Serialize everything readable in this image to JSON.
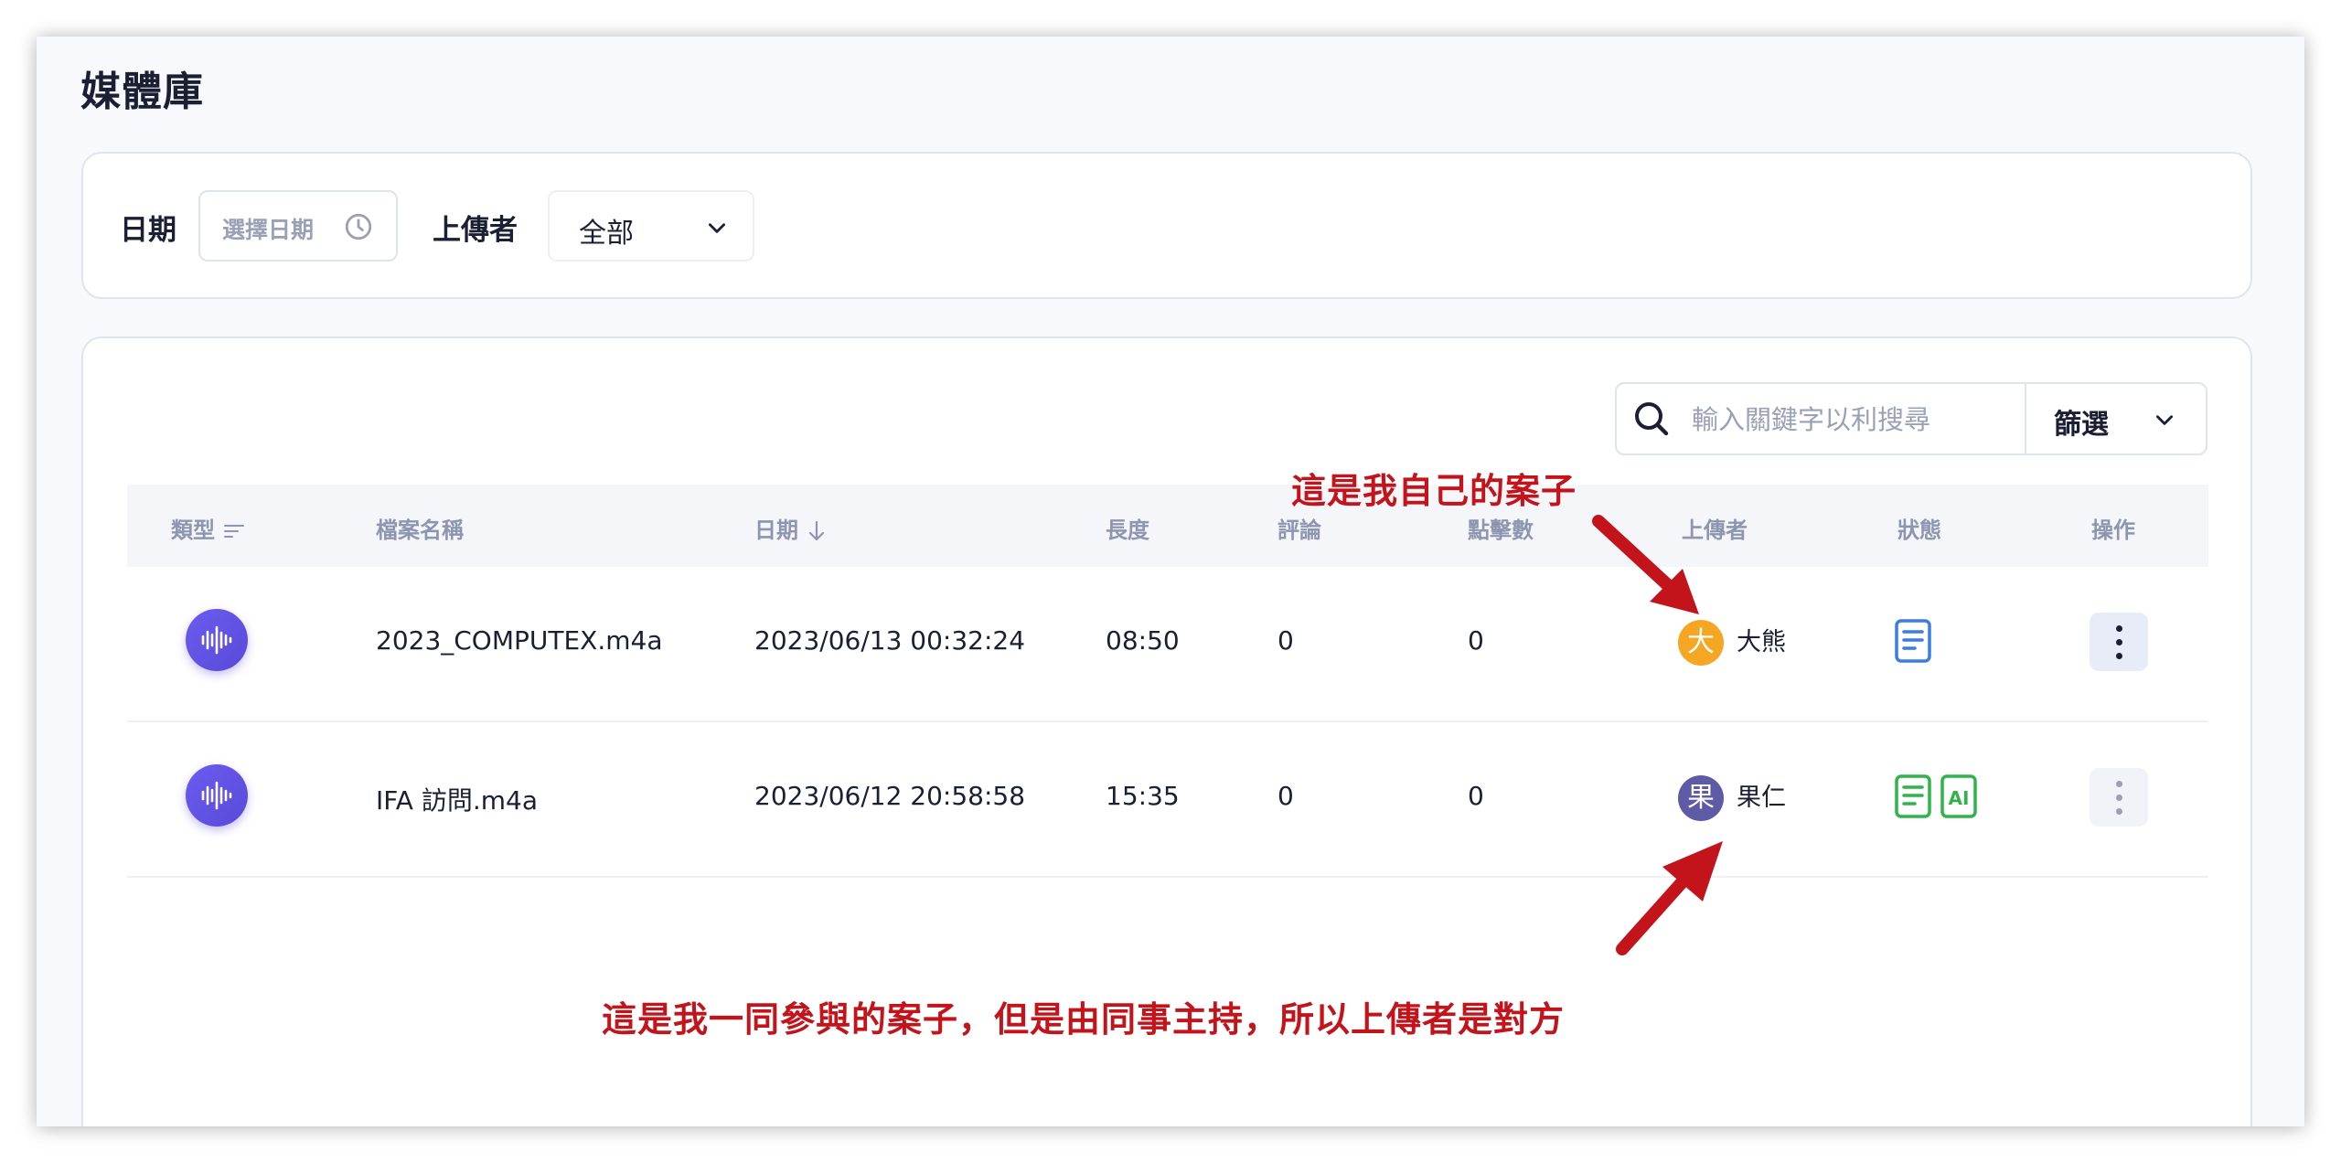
{
  "page": {
    "title": "媒體庫"
  },
  "filters": {
    "date_label": "日期",
    "date_placeholder": "選擇日期",
    "uploader_label": "上傳者",
    "uploader_value": "全部"
  },
  "search": {
    "placeholder": "輸入關鍵字以利搜尋",
    "filter_label": "篩選"
  },
  "table": {
    "headers": {
      "type": "類型",
      "filename": "檔案名稱",
      "date": "日期",
      "length": "長度",
      "comments": "評論",
      "clicks": "點擊數",
      "uploader": "上傳者",
      "status": "狀態",
      "actions": "操作"
    },
    "rows": [
      {
        "type_icon": "audio-waveform-icon",
        "filename": "2023_COMPUTEX.m4a",
        "date": "2023/06/13 00:32:24",
        "length": "08:50",
        "comments": "0",
        "clicks": "0",
        "uploader_avatar": "大",
        "uploader_name": "大熊",
        "avatar_color": "#f5a623",
        "status": [
          "transcript-icon"
        ],
        "status_color": "#3b7de3"
      },
      {
        "type_icon": "audio-waveform-icon",
        "filename": "IFA 訪問.m4a",
        "date": "2023/06/12 20:58:58",
        "length": "15:35",
        "comments": "0",
        "clicks": "0",
        "uploader_avatar": "果",
        "uploader_name": "果仁",
        "avatar_color": "#5e5aa6",
        "status": [
          "transcript-icon",
          "ai-icon"
        ],
        "status_color": "#2fb34a"
      }
    ]
  },
  "annotations": {
    "top": "這是我自己的案子",
    "bottom": "這是我一同參與的案子，但是由同事主持，所以上傳者是對方",
    "color": "#c4141b"
  },
  "colors": {
    "accent": "#5b4ad8",
    "background": "#f7f9fc",
    "border": "#dfe4ee"
  }
}
